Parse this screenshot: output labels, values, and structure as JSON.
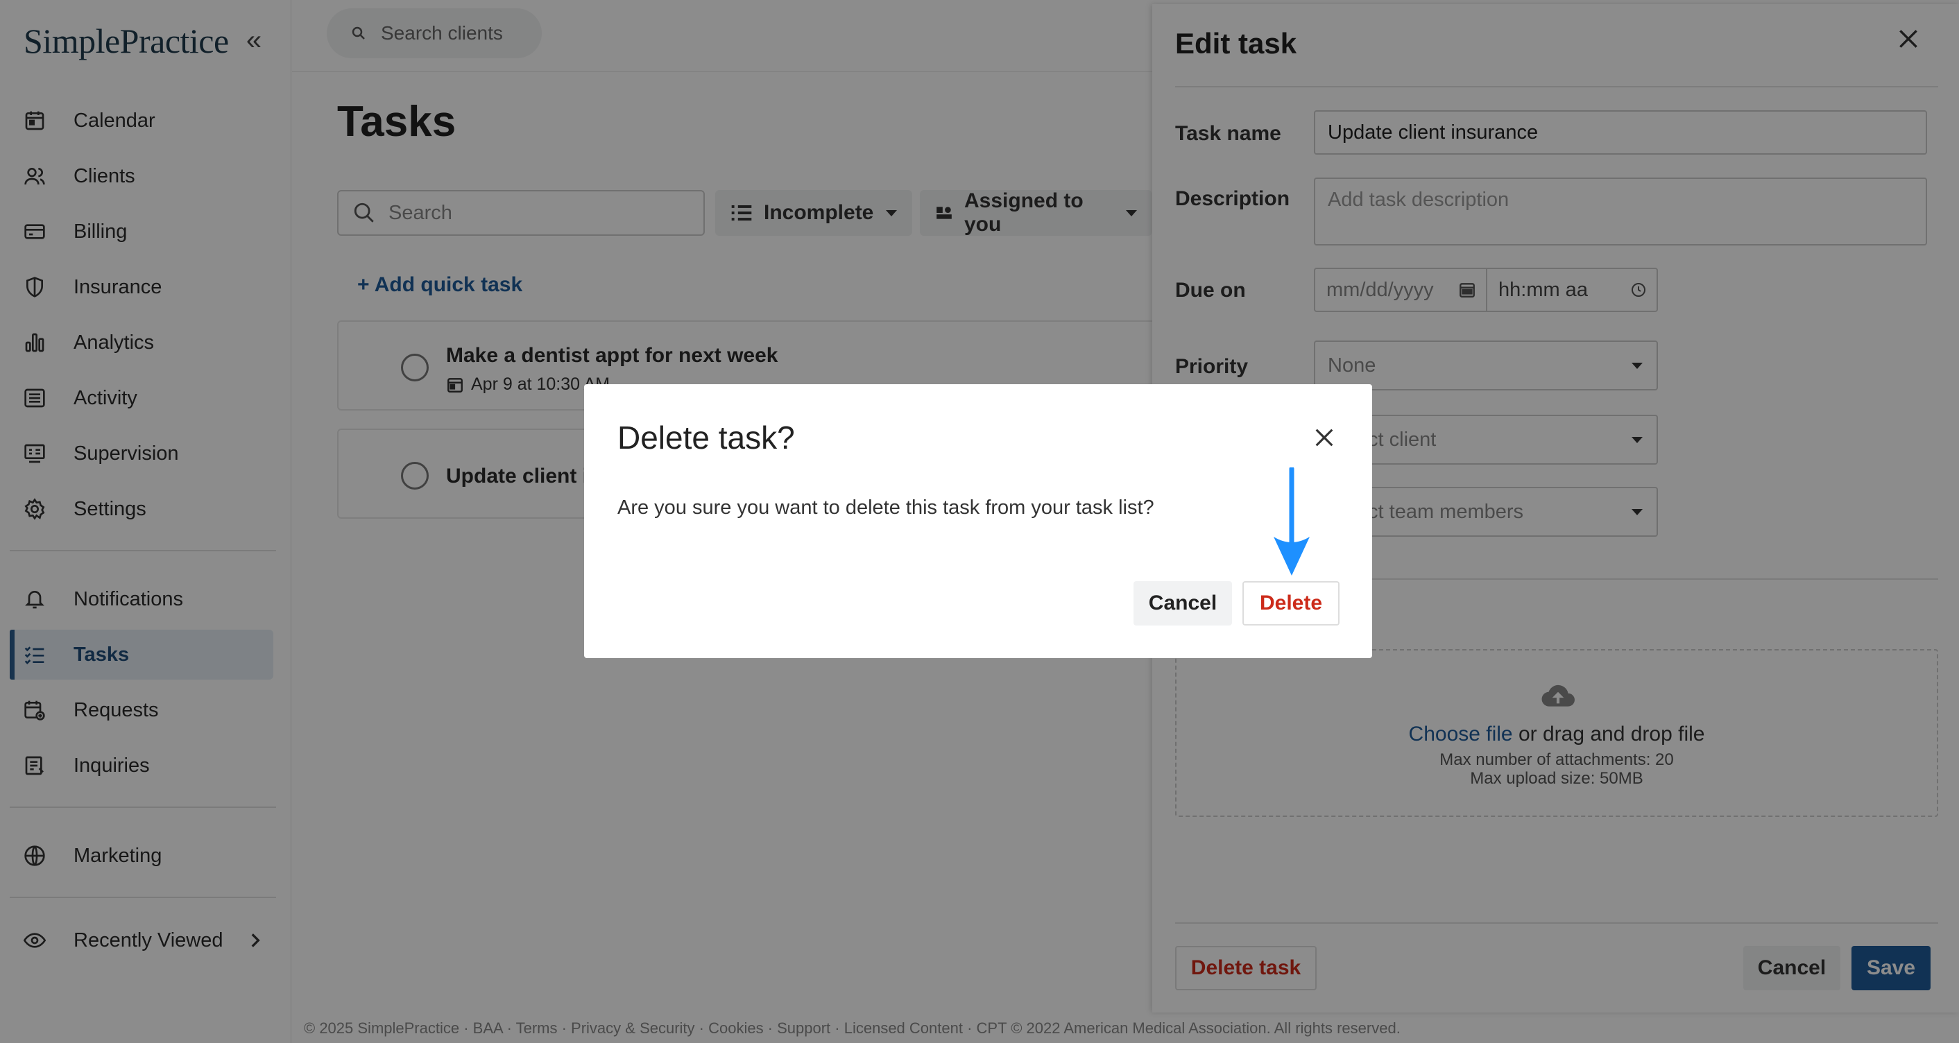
{
  "sidebar": {
    "logo": "SimplePractice",
    "collapse_icon": "«",
    "items": [
      {
        "label": "Calendar",
        "icon": "calendar-icon"
      },
      {
        "label": "Clients",
        "icon": "users-icon"
      },
      {
        "label": "Billing",
        "icon": "credit-card-icon"
      },
      {
        "label": "Insurance",
        "icon": "shield-icon"
      },
      {
        "label": "Analytics",
        "icon": "bar-chart-icon"
      },
      {
        "label": "Activity",
        "icon": "list-icon"
      },
      {
        "label": "Supervision",
        "icon": "supervision-icon"
      },
      {
        "label": "Settings",
        "icon": "gear-icon"
      },
      {
        "label": "Notifications",
        "icon": "bell-icon"
      },
      {
        "label": "Tasks",
        "icon": "tasks-icon",
        "active": true
      },
      {
        "label": "Requests",
        "icon": "calendar-plus-icon"
      },
      {
        "label": "Inquiries",
        "icon": "inbox-list-icon"
      },
      {
        "label": "Marketing",
        "icon": "globe-icon"
      },
      {
        "label": "Recently Viewed",
        "icon": "eye-icon"
      }
    ]
  },
  "topbar": {
    "search_placeholder": "Search clients"
  },
  "main": {
    "title": "Tasks",
    "search_placeholder": "Search",
    "filter_status": "Incomplete",
    "filter_assignee": "Assigned to you",
    "add_quick_task": "+ Add quick task",
    "tasks": [
      {
        "name": "Make a dentist appt for next week",
        "due": "Apr 9 at 10:30 AM"
      },
      {
        "name": "Update client insurance"
      }
    ]
  },
  "panel": {
    "title": "Edit task",
    "task_name_label": "Task name",
    "task_name_value": "Update client insurance",
    "description_label": "Description",
    "description_placeholder": "Add task description",
    "due_label": "Due on",
    "date_placeholder": "mm/dd/yyyy",
    "time_placeholder": "hh:mm aa",
    "priority_label": "Priority",
    "priority_value": "None",
    "client_placeholder": "Select client",
    "team_placeholder": "Select team members",
    "choose_file": "Choose file",
    "drag_drop": " or drag and drop file",
    "max_attachments": "Max number of attachments: 20",
    "max_upload": "Max upload size: 50MB",
    "delete_task": "Delete task",
    "cancel": "Cancel",
    "save": "Save"
  },
  "modal": {
    "title": "Delete task?",
    "body": "Are you sure you want to delete this task from your task list?",
    "cancel": "Cancel",
    "delete": "Delete"
  },
  "footer": "© 2025 SimplePractice · BAA · Terms · Privacy & Security · Cookies · Support · Licensed Content · CPT © 2022 American Medical Association. All rights reserved.",
  "colors": {
    "brand": "#1f5c99",
    "danger": "#cc2b1a",
    "arrow": "#1e90ff",
    "active_nav": "#e6edf5"
  }
}
